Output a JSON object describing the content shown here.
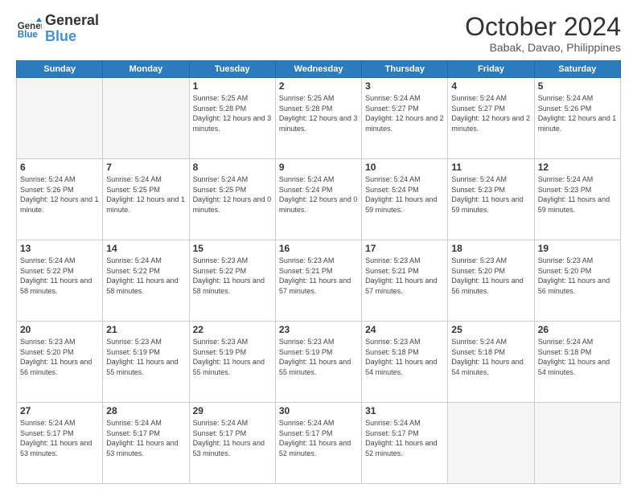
{
  "logo": {
    "line1": "General",
    "line2": "Blue"
  },
  "header": {
    "month": "October 2024",
    "location": "Babak, Davao, Philippines"
  },
  "weekdays": [
    "Sunday",
    "Monday",
    "Tuesday",
    "Wednesday",
    "Thursday",
    "Friday",
    "Saturday"
  ],
  "weeks": [
    [
      {
        "day": "",
        "empty": true
      },
      {
        "day": "",
        "empty": true
      },
      {
        "day": "1",
        "sunrise": "Sunrise: 5:25 AM",
        "sunset": "Sunset: 5:28 PM",
        "daylight": "Daylight: 12 hours and 3 minutes."
      },
      {
        "day": "2",
        "sunrise": "Sunrise: 5:25 AM",
        "sunset": "Sunset: 5:28 PM",
        "daylight": "Daylight: 12 hours and 3 minutes."
      },
      {
        "day": "3",
        "sunrise": "Sunrise: 5:24 AM",
        "sunset": "Sunset: 5:27 PM",
        "daylight": "Daylight: 12 hours and 2 minutes."
      },
      {
        "day": "4",
        "sunrise": "Sunrise: 5:24 AM",
        "sunset": "Sunset: 5:27 PM",
        "daylight": "Daylight: 12 hours and 2 minutes."
      },
      {
        "day": "5",
        "sunrise": "Sunrise: 5:24 AM",
        "sunset": "Sunset: 5:26 PM",
        "daylight": "Daylight: 12 hours and 1 minute."
      }
    ],
    [
      {
        "day": "6",
        "sunrise": "Sunrise: 5:24 AM",
        "sunset": "Sunset: 5:26 PM",
        "daylight": "Daylight: 12 hours and 1 minute."
      },
      {
        "day": "7",
        "sunrise": "Sunrise: 5:24 AM",
        "sunset": "Sunset: 5:25 PM",
        "daylight": "Daylight: 12 hours and 1 minute."
      },
      {
        "day": "8",
        "sunrise": "Sunrise: 5:24 AM",
        "sunset": "Sunset: 5:25 PM",
        "daylight": "Daylight: 12 hours and 0 minutes."
      },
      {
        "day": "9",
        "sunrise": "Sunrise: 5:24 AM",
        "sunset": "Sunset: 5:24 PM",
        "daylight": "Daylight: 12 hours and 0 minutes."
      },
      {
        "day": "10",
        "sunrise": "Sunrise: 5:24 AM",
        "sunset": "Sunset: 5:24 PM",
        "daylight": "Daylight: 11 hours and 59 minutes."
      },
      {
        "day": "11",
        "sunrise": "Sunrise: 5:24 AM",
        "sunset": "Sunset: 5:23 PM",
        "daylight": "Daylight: 11 hours and 59 minutes."
      },
      {
        "day": "12",
        "sunrise": "Sunrise: 5:24 AM",
        "sunset": "Sunset: 5:23 PM",
        "daylight": "Daylight: 11 hours and 59 minutes."
      }
    ],
    [
      {
        "day": "13",
        "sunrise": "Sunrise: 5:24 AM",
        "sunset": "Sunset: 5:22 PM",
        "daylight": "Daylight: 11 hours and 58 minutes."
      },
      {
        "day": "14",
        "sunrise": "Sunrise: 5:24 AM",
        "sunset": "Sunset: 5:22 PM",
        "daylight": "Daylight: 11 hours and 58 minutes."
      },
      {
        "day": "15",
        "sunrise": "Sunrise: 5:23 AM",
        "sunset": "Sunset: 5:22 PM",
        "daylight": "Daylight: 11 hours and 58 minutes."
      },
      {
        "day": "16",
        "sunrise": "Sunrise: 5:23 AM",
        "sunset": "Sunset: 5:21 PM",
        "daylight": "Daylight: 11 hours and 57 minutes."
      },
      {
        "day": "17",
        "sunrise": "Sunrise: 5:23 AM",
        "sunset": "Sunset: 5:21 PM",
        "daylight": "Daylight: 11 hours and 57 minutes."
      },
      {
        "day": "18",
        "sunrise": "Sunrise: 5:23 AM",
        "sunset": "Sunset: 5:20 PM",
        "daylight": "Daylight: 11 hours and 56 minutes."
      },
      {
        "day": "19",
        "sunrise": "Sunrise: 5:23 AM",
        "sunset": "Sunset: 5:20 PM",
        "daylight": "Daylight: 11 hours and 56 minutes."
      }
    ],
    [
      {
        "day": "20",
        "sunrise": "Sunrise: 5:23 AM",
        "sunset": "Sunset: 5:20 PM",
        "daylight": "Daylight: 11 hours and 56 minutes."
      },
      {
        "day": "21",
        "sunrise": "Sunrise: 5:23 AM",
        "sunset": "Sunset: 5:19 PM",
        "daylight": "Daylight: 11 hours and 55 minutes."
      },
      {
        "day": "22",
        "sunrise": "Sunrise: 5:23 AM",
        "sunset": "Sunset: 5:19 PM",
        "daylight": "Daylight: 11 hours and 55 minutes."
      },
      {
        "day": "23",
        "sunrise": "Sunrise: 5:23 AM",
        "sunset": "Sunset: 5:19 PM",
        "daylight": "Daylight: 11 hours and 55 minutes."
      },
      {
        "day": "24",
        "sunrise": "Sunrise: 5:23 AM",
        "sunset": "Sunset: 5:18 PM",
        "daylight": "Daylight: 11 hours and 54 minutes."
      },
      {
        "day": "25",
        "sunrise": "Sunrise: 5:24 AM",
        "sunset": "Sunset: 5:18 PM",
        "daylight": "Daylight: 11 hours and 54 minutes."
      },
      {
        "day": "26",
        "sunrise": "Sunrise: 5:24 AM",
        "sunset": "Sunset: 5:18 PM",
        "daylight": "Daylight: 11 hours and 54 minutes."
      }
    ],
    [
      {
        "day": "27",
        "sunrise": "Sunrise: 5:24 AM",
        "sunset": "Sunset: 5:17 PM",
        "daylight": "Daylight: 11 hours and 53 minutes."
      },
      {
        "day": "28",
        "sunrise": "Sunrise: 5:24 AM",
        "sunset": "Sunset: 5:17 PM",
        "daylight": "Daylight: 11 hours and 53 minutes."
      },
      {
        "day": "29",
        "sunrise": "Sunrise: 5:24 AM",
        "sunset": "Sunset: 5:17 PM",
        "daylight": "Daylight: 11 hours and 53 minutes."
      },
      {
        "day": "30",
        "sunrise": "Sunrise: 5:24 AM",
        "sunset": "Sunset: 5:17 PM",
        "daylight": "Daylight: 11 hours and 52 minutes."
      },
      {
        "day": "31",
        "sunrise": "Sunrise: 5:24 AM",
        "sunset": "Sunset: 5:17 PM",
        "daylight": "Daylight: 11 hours and 52 minutes."
      },
      {
        "day": "",
        "empty": true
      },
      {
        "day": "",
        "empty": true
      }
    ]
  ]
}
